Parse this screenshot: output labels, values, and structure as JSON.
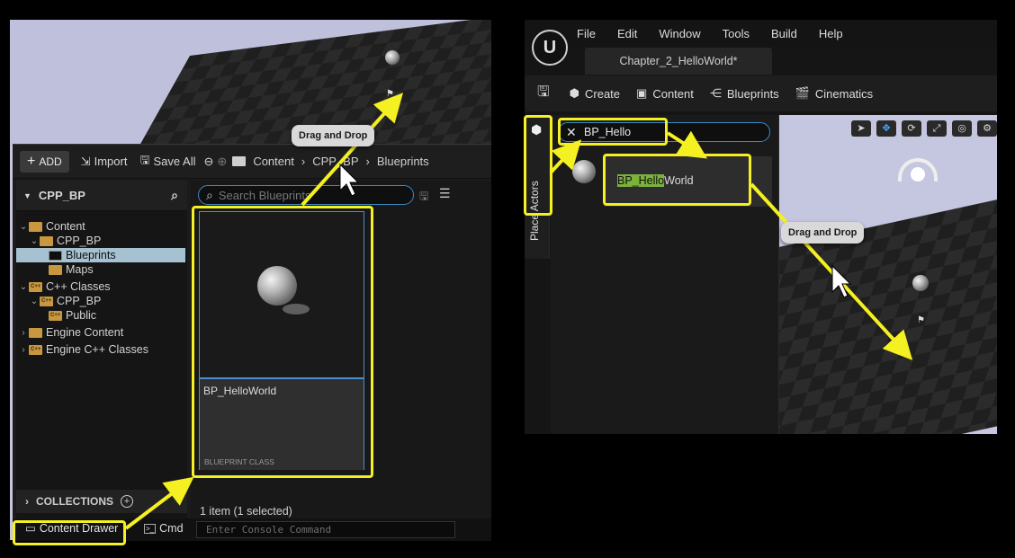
{
  "left": {
    "toolbar": {
      "add_label": "ADD",
      "import_label": "Import",
      "save_all_label": "Save All",
      "breadcrumb": [
        "Content",
        "CPP_BP",
        "Blueprints"
      ]
    },
    "tree": {
      "header": "CPP_BP",
      "items": [
        {
          "label": "Content"
        },
        {
          "label": "CPP_BP"
        },
        {
          "label": "Blueprints"
        },
        {
          "label": "Maps"
        },
        {
          "label": "C++ Classes"
        },
        {
          "label": "CPP_BP"
        },
        {
          "label": "Public"
        },
        {
          "label": "Engine Content"
        },
        {
          "label": "Engine C++ Classes"
        }
      ],
      "collections_label": "COLLECTIONS"
    },
    "search": {
      "placeholder": "Search Blueprints"
    },
    "asset": {
      "name": "BP_HelloWorld",
      "class": "BLUEPRINT CLASS"
    },
    "status": "1 item (1 selected)",
    "bottom": {
      "content_drawer_label": "Content Drawer",
      "cmd_label": "Cmd",
      "console_placeholder": "Enter Console Command"
    },
    "drag_bubble": "Drag and Drop"
  },
  "right": {
    "menu": [
      "File",
      "Edit",
      "Window",
      "Tools",
      "Build",
      "Help"
    ],
    "logo": "U",
    "doc_tab": "Chapter_2_HelloWorld*",
    "toolbar": {
      "create_label": "Create",
      "content_label": "Content",
      "blueprints_label": "Blueprints",
      "cinematics_label": "Cinematics"
    },
    "side_tab_label": "Place Actors",
    "search_value": "BP_Hello",
    "result": {
      "match": "BP_Hello",
      "rest": "World"
    },
    "drag_bubble": "Drag and Drop"
  },
  "colors": {
    "highlight": "#f4f021",
    "selection": "#4a8ed0",
    "match_highlight": "#7bb23d"
  }
}
